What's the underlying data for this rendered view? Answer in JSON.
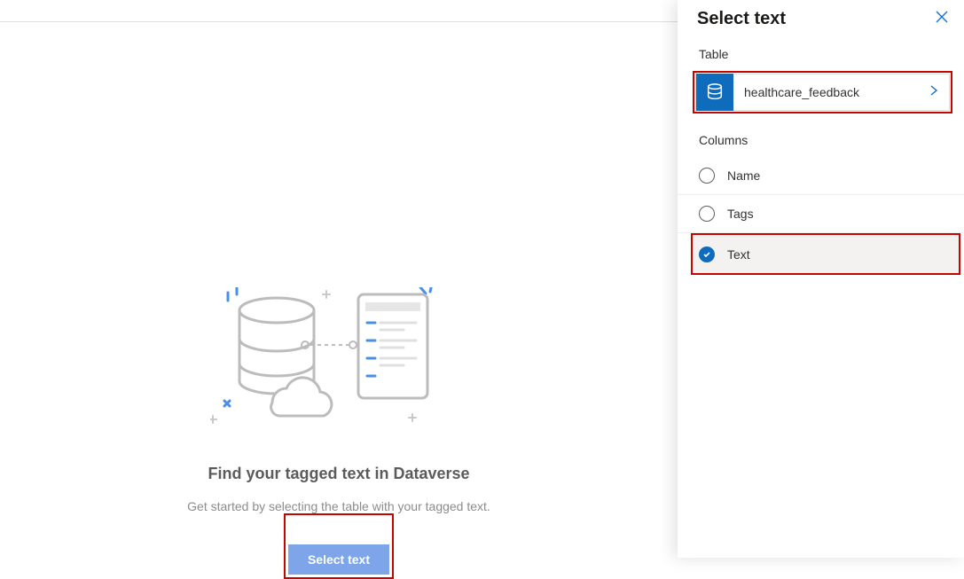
{
  "main": {
    "heading": "Find your tagged text in Dataverse",
    "subtext": "Get started by selecting the table with your tagged text.",
    "button_label": "Select text"
  },
  "panel": {
    "title": "Select text",
    "table_section_label": "Table",
    "table_name": "healthcare_feedback",
    "columns_section_label": "Columns",
    "columns": [
      {
        "label": "Name",
        "selected": false
      },
      {
        "label": "Tags",
        "selected": false
      },
      {
        "label": "Text",
        "selected": true
      }
    ]
  }
}
